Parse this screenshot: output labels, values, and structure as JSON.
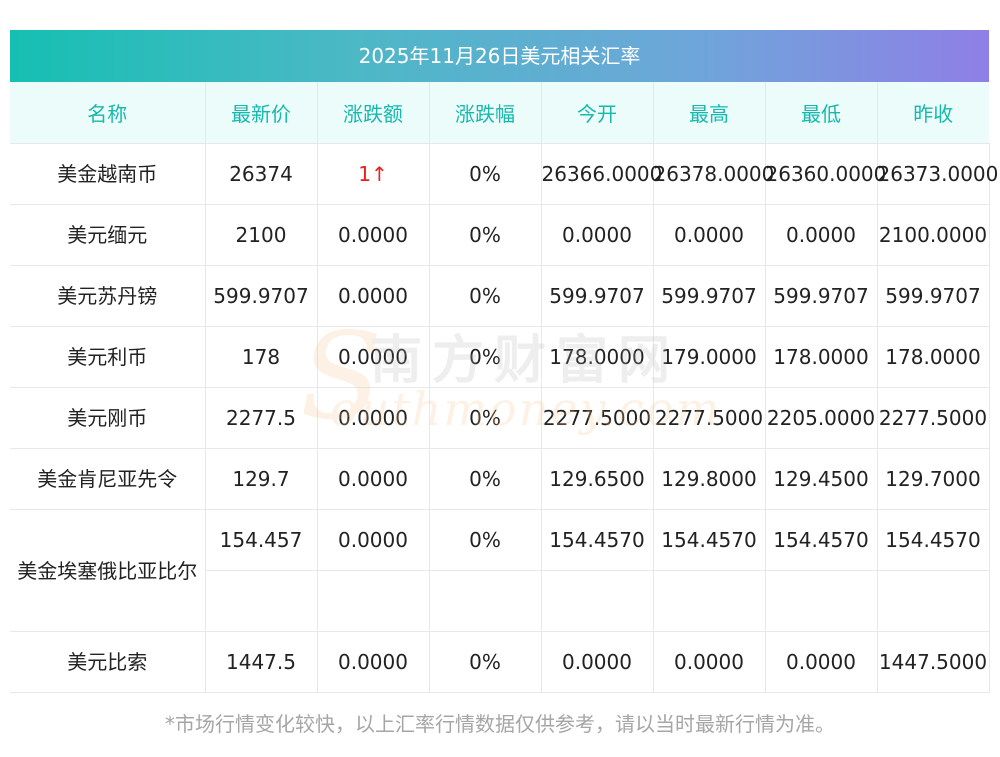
{
  "title": "2025年11月26日美元相关汇率",
  "headers": [
    "名称",
    "最新价",
    "涨跌额",
    "涨跌幅",
    "今开",
    "最高",
    "最低",
    "昨收"
  ],
  "rows": [
    {
      "name": "美金越南币",
      "latest": "26374",
      "change": "1↑",
      "pct": "0%",
      "open": "26366.0000",
      "high": "26378.0000",
      "low": "26360.0000",
      "prev": "26373.0000"
    },
    {
      "name": "美元缅元",
      "latest": "2100",
      "change": "0.0000",
      "pct": "0%",
      "open": "0.0000",
      "high": "0.0000",
      "low": "0.0000",
      "prev": "2100.0000"
    },
    {
      "name": "美元苏丹镑",
      "latest": "599.9707",
      "change": "0.0000",
      "pct": "0%",
      "open": "599.9707",
      "high": "599.9707",
      "low": "599.9707",
      "prev": "599.9707"
    },
    {
      "name": "美元利币",
      "latest": "178",
      "change": "0.0000",
      "pct": "0%",
      "open": "178.0000",
      "high": "179.0000",
      "low": "178.0000",
      "prev": "178.0000"
    },
    {
      "name": "美元刚币",
      "latest": "2277.5",
      "change": "0.0000",
      "pct": "0%",
      "open": "2277.5000",
      "high": "2277.5000",
      "low": "2205.0000",
      "prev": "2277.5000"
    },
    {
      "name": "美金肯尼亚先令",
      "latest": "129.7",
      "change": "0.0000",
      "pct": "0%",
      "open": "129.6500",
      "high": "129.8000",
      "low": "129.4500",
      "prev": "129.7000"
    },
    {
      "name": "美金埃塞俄比亚比尔",
      "latest": "154.457",
      "change": "0.0000",
      "pct": "0%",
      "open": "154.4570",
      "high": "154.4570",
      "low": "154.4570",
      "prev": "154.4570"
    },
    {
      "name": "美元比索",
      "latest": "1447.5",
      "change": "0.0000",
      "pct": "0%",
      "open": "0.0000",
      "high": "0.0000",
      "low": "0.0000",
      "prev": "1447.5000"
    }
  ],
  "watermark": {
    "cn": "南方财富网",
    "en": "outhmoney.com",
    "s": "S"
  },
  "footnote": "*市场行情变化较快，以上汇率行情数据仅供参考，请以当时最新行情为准。",
  "colors": {
    "accent": "#17b9ad",
    "up": "#e82020",
    "header_bg": "#ecfcfb"
  }
}
